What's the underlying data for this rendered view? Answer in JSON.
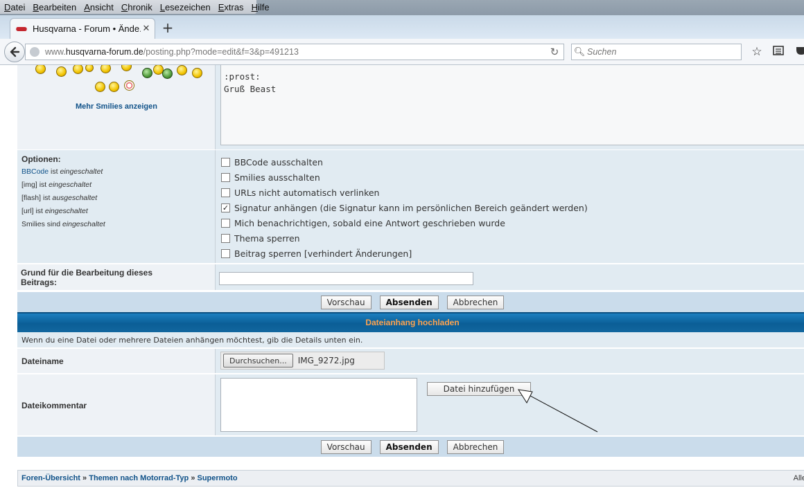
{
  "browser": {
    "menu": [
      "Datei",
      "Bearbeiten",
      "Ansicht",
      "Chronik",
      "Lesezeichen",
      "Extras",
      "Hilfe"
    ],
    "tab_title": "Husqvarna - Forum • Ände...",
    "tab_close": "✕",
    "new_tab": "+",
    "url_prefix": "www.",
    "url_host": "husqvarna-forum.de",
    "url_path": "/posting.php?mode=edit&f=3&p=491213",
    "search_placeholder": "Suchen"
  },
  "smilies": {
    "more_link": "Mehr Smilies anzeigen"
  },
  "message": {
    "text": ":prost:\nGruß Beast"
  },
  "options": {
    "label": "Optionen:",
    "status": [
      {
        "name": "BBCode",
        "is": "ist",
        "state": "eingeschaltet",
        "link": true
      },
      {
        "name": "[img]",
        "is": "ist",
        "state": "eingeschaltet",
        "link": false
      },
      {
        "name": "[flash]",
        "is": "ist",
        "state": "ausgeschaltet",
        "link": false
      },
      {
        "name": "[url]",
        "is": "ist",
        "state": "eingeschaltet",
        "link": false
      },
      {
        "name": "Smilies",
        "is": "sind",
        "state": "eingeschaltet",
        "link": false
      }
    ],
    "checkboxes": [
      {
        "label": "BBCode ausschalten",
        "checked": false
      },
      {
        "label": "Smilies ausschalten",
        "checked": false
      },
      {
        "label": "URLs nicht automatisch verlinken",
        "checked": false
      },
      {
        "label": "Signatur anhängen (die Signatur kann im persönlichen Bereich geändert werden)",
        "checked": true
      },
      {
        "label": "Mich benachrichtigen, sobald eine Antwort geschrieben wurde",
        "checked": false
      },
      {
        "label": "Thema sperren",
        "checked": false
      },
      {
        "label": "Beitrag sperren [verhindert Änderungen]",
        "checked": false
      }
    ]
  },
  "edit_reason": {
    "label_line1": "Grund für die Bearbeitung dieses",
    "label_line2": "Beitrags:",
    "value": ""
  },
  "buttons": {
    "preview": "Vorschau",
    "submit": "Absenden",
    "cancel": "Abbrechen"
  },
  "attachment": {
    "header": "Dateianhang hochladen",
    "info": "Wenn du eine Datei oder mehrere Dateien anhängen möchtest, gib die Details unten ein.",
    "filename_label": "Dateiname",
    "browse_button": "Durchsuchen...",
    "selected_file": "IMG_9272.jpg",
    "comment_label": "Dateikommentar",
    "comment_value": "",
    "add_button": "Datei hinzufügen"
  },
  "breadcrumb": {
    "items": [
      "Foren-Übersicht",
      "Themen nach Motorrad-Typ",
      "Supermoto"
    ],
    "separator": "»",
    "right_text": "Alle"
  }
}
